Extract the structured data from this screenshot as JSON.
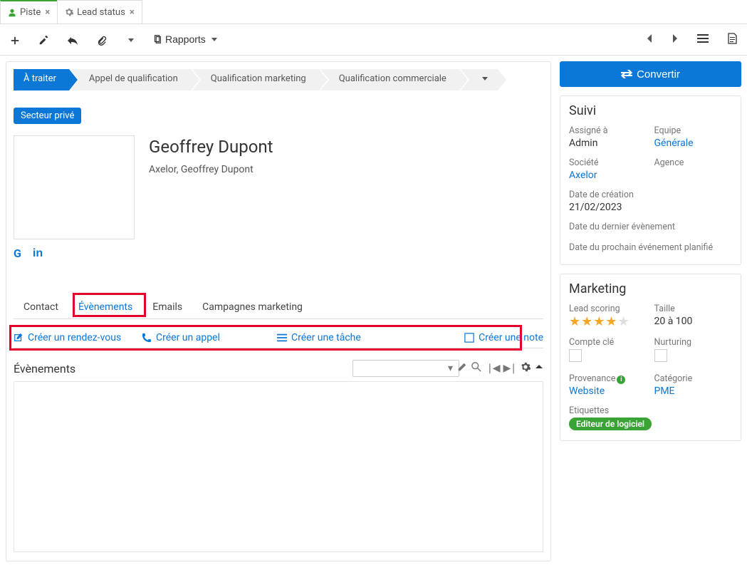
{
  "app_tabs": [
    {
      "icon": "user",
      "label": "Piste",
      "active": true
    },
    {
      "icon": "gear",
      "label": "Lead status",
      "active": false
    }
  ],
  "toolbar": {
    "reports_label": "Rapports"
  },
  "stages": {
    "items": [
      "À traiter",
      "Appel de qualification",
      "Qualification marketing",
      "Qualification commerciale"
    ],
    "active_index": 0,
    "more": "▾"
  },
  "sector_badge": "Secteur privé",
  "lead": {
    "name": "Geoffrey Dupont",
    "subtitle": "Axelor, Geoffrey Dupont"
  },
  "social": {
    "google": "G",
    "linkedin": "in"
  },
  "detail_tabs": {
    "items": [
      "Contact",
      "Évènements",
      "Emails",
      "Campagnes marketing"
    ],
    "active_index": 1
  },
  "actions": {
    "create_meeting": "Créer un rendez-vous",
    "create_call": "Créer un appel",
    "create_task": "Créer une tâche",
    "create_note": "Créer une note"
  },
  "events_section": {
    "title": "Évènements"
  },
  "right": {
    "convert": "Convertir",
    "suivi_heading": "Suivi",
    "assigned_label": "Assigné à",
    "assigned_value": "Admin",
    "team_label": "Equipe",
    "team_value": "Générale",
    "company_label": "Société",
    "company_value": "Axelor",
    "agency_label": "Agence",
    "created_label": "Date de création",
    "created_value": "21/02/2023",
    "last_event_label": "Date du dernier évènement",
    "next_event_label": "Date du prochain événement planifié",
    "marketing_heading": "Marketing",
    "scoring_label": "Lead scoring",
    "scoring_stars": 4,
    "size_label": "Taille",
    "size_value": "20 à 100",
    "key_account_label": "Compte clé",
    "nurturing_label": "Nurturing",
    "source_label": "Provenance",
    "source_value": "Website",
    "category_label": "Catégorie",
    "category_value": "PME",
    "tags_label": "Etiquettes",
    "tag_value": "Editeur de logiciel"
  }
}
